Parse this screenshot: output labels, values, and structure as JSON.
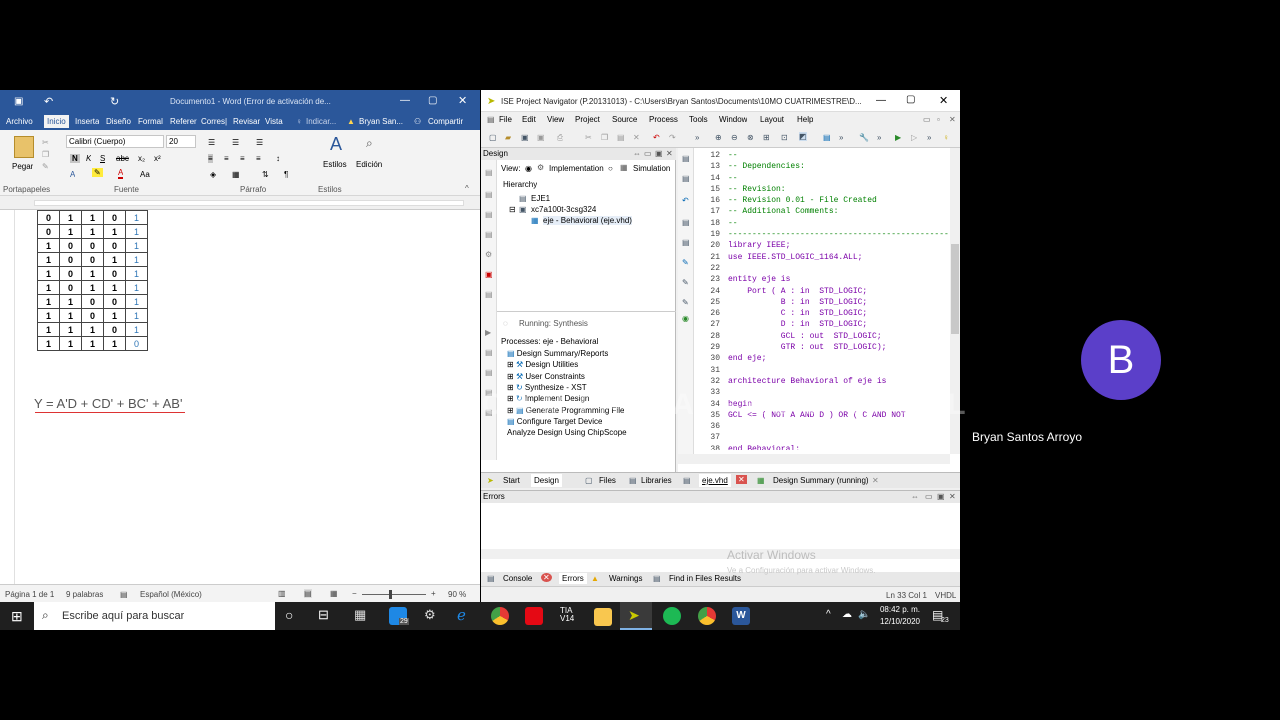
{
  "word": {
    "title": "Documento1 - Word (Error de activación de...",
    "tabs": [
      "Archivo",
      "Inicio",
      "Inserta",
      "Diseño",
      "Formal",
      "Referer",
      "Corres|",
      "Revisar",
      "Vista"
    ],
    "tell_me": "Indicar...",
    "user": "Bryan San...",
    "share": "Compartir",
    "font_name": "Calibri (Cuerpo)",
    "font_size": "20",
    "paste_label": "Pegar",
    "styles_label": "Estilos",
    "edit_label": "Edición",
    "groups": [
      "Portapapeles",
      "Fuente",
      "Párrafo",
      "Estilos"
    ],
    "truth_table": [
      [
        "0",
        "1",
        "1",
        "0",
        "1"
      ],
      [
        "0",
        "1",
        "1",
        "1",
        "1"
      ],
      [
        "1",
        "0",
        "0",
        "0",
        "1"
      ],
      [
        "1",
        "0",
        "0",
        "1",
        "1"
      ],
      [
        "1",
        "0",
        "1",
        "0",
        "1"
      ],
      [
        "1",
        "0",
        "1",
        "1",
        "1"
      ],
      [
        "1",
        "1",
        "0",
        "0",
        "1"
      ],
      [
        "1",
        "1",
        "0",
        "1",
        "1"
      ],
      [
        "1",
        "1",
        "1",
        "0",
        "1"
      ],
      [
        "1",
        "1",
        "1",
        "1",
        "0"
      ]
    ],
    "equation": "Y = A'D + CD' + BC' + AB'",
    "status_page": "Página 1 de 1",
    "status_words": "9 palabras",
    "status_lang": "Español (México)",
    "zoom": "90 %"
  },
  "ise": {
    "title": "ISE Project Navigator (P.20131013) - C:\\Users\\Bryan Santos\\Documents\\10MO CUATRIMESTRE\\D...",
    "menu": [
      "File",
      "Edit",
      "View",
      "Project",
      "Source",
      "Process",
      "Tools",
      "Window",
      "Layout",
      "Help"
    ],
    "design_label": "Design",
    "view_label": "View:",
    "impl_label": "Implementation",
    "sim_label": "Simulation",
    "hierarchy_label": "Hierarchy",
    "tree": [
      "EJE1",
      "xc7a100t-3csg324",
      "eje - Behavioral (eje.vhd)"
    ],
    "running": "Running: Synthesis",
    "processes_label": "Processes: eje - Behavioral",
    "processes": [
      "Design Summary/Reports",
      "Design Utilities",
      "User Constraints",
      "Synthesize - XST",
      "Implement Design",
      "Generate Programming File",
      "Configure Target Device",
      "Analyze Design Using ChipScope"
    ],
    "code_lines": [
      {
        "n": "12",
        "t": "--"
      },
      {
        "n": "13",
        "t": "-- Dependencies:"
      },
      {
        "n": "14",
        "t": "--"
      },
      {
        "n": "15",
        "t": "-- Revision:"
      },
      {
        "n": "16",
        "t": "-- Revision 0.01 - File Created"
      },
      {
        "n": "17",
        "t": "-- Additional Comments:"
      },
      {
        "n": "18",
        "t": "--"
      },
      {
        "n": "19",
        "t": "----------------------------------------------"
      },
      {
        "n": "20",
        "t": "library IEEE;"
      },
      {
        "n": "21",
        "t": "use IEEE.STD_LOGIC_1164.ALL;"
      },
      {
        "n": "22",
        "t": ""
      },
      {
        "n": "23",
        "t": "entity eje is"
      },
      {
        "n": "24",
        "t": "    Port ( A : in  STD_LOGIC;"
      },
      {
        "n": "25",
        "t": "           B : in  STD_LOGIC;"
      },
      {
        "n": "26",
        "t": "           C : in  STD_LOGIC;"
      },
      {
        "n": "27",
        "t": "           D : in  STD_LOGIC;"
      },
      {
        "n": "28",
        "t": "           GCL : out  STD_LOGIC;"
      },
      {
        "n": "29",
        "t": "           GTR : out  STD_LOGIC);"
      },
      {
        "n": "30",
        "t": "end eje;"
      },
      {
        "n": "31",
        "t": ""
      },
      {
        "n": "32",
        "t": "architecture Behavioral of eje is"
      },
      {
        "n": "33",
        "t": ""
      },
      {
        "n": "34",
        "t": "begin"
      },
      {
        "n": "35",
        "t": "GCL <= ( NOT A AND D ) OR ( C AND NOT"
      },
      {
        "n": "36",
        "t": ""
      },
      {
        "n": "37",
        "t": ""
      },
      {
        "n": "38",
        "t": "end Behavioral;"
      }
    ],
    "bottom_tabs": [
      "Start",
      "Design",
      "Files",
      "Libraries"
    ],
    "file_tab": "eje.vhd",
    "summary_tab": "Design Summary (running)",
    "errors_label": "Errors",
    "console_tabs": [
      "Console",
      "Errors",
      "Warnings",
      "Find in Files Results"
    ],
    "status_pos": "Ln 33 Col 1",
    "status_lang": "VHDL"
  },
  "taskbar": {
    "search_placeholder": "Escribe aquí para buscar",
    "time": "08:42 p. m.",
    "date": "12/10/2020",
    "notif_count": "23",
    "mail_badge": "29"
  },
  "overlay": {
    "avatar_letter": "B",
    "user_name": "Bryan Santos Arroyo",
    "watermark": "MADE WITH CAMTASIA FREE TRIAL",
    "activate_title": "Activar Windows",
    "activate_sub": "Ve a Configuración para activar Windows."
  },
  "colors": {
    "word_blue": "#2b579a",
    "avatar": "#5b3fc9",
    "vhdl_comment": "#008000",
    "vhdl_keyword": "#7b00a8",
    "vhdl_type": "#d40000"
  }
}
